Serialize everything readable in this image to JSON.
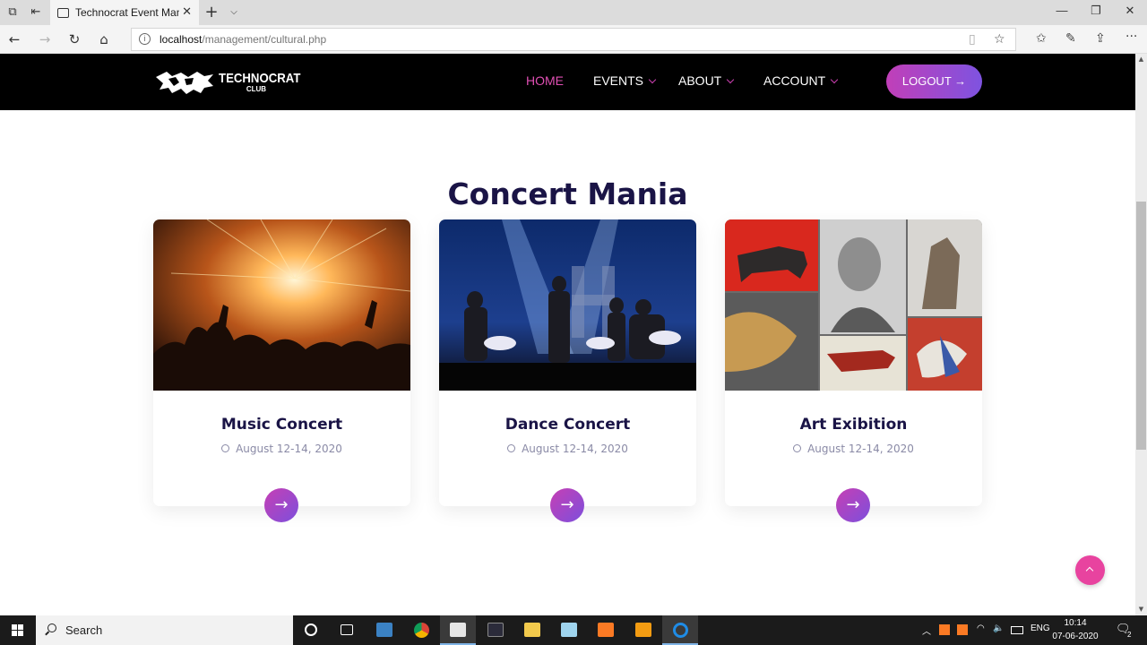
{
  "browser": {
    "tab_title": "Technocrat Event Manag",
    "url_host": "localhost",
    "url_path": "/management/cultural.php"
  },
  "site": {
    "logo": {
      "line1": "TECHNOCRAT",
      "line2": "CLUB"
    },
    "menu": [
      {
        "label": "HOME",
        "active": true,
        "dropdown": false
      },
      {
        "label": "EVENTS",
        "active": false,
        "dropdown": true
      },
      {
        "label": "ABOUT",
        "active": false,
        "dropdown": true
      },
      {
        "label": "ACCOUNT",
        "active": false,
        "dropdown": true
      }
    ],
    "logout_label": "LOGOUT →"
  },
  "section": {
    "title": "Concert Mania"
  },
  "cards": [
    {
      "title": "Music Concert",
      "date": "August 12-14, 2020",
      "image": "concert-crowd-photo",
      "arrow": "→"
    },
    {
      "title": "Dance Concert",
      "date": "August 12-14, 2020",
      "image": "dance-stage-photo",
      "arrow": "→"
    },
    {
      "title": "Art Exibition",
      "date": "August 12-14, 2020",
      "image": "art-collage-photo",
      "arrow": "→"
    }
  ],
  "taskbar": {
    "search_label": "Search",
    "language": "ENG",
    "time": "10:14",
    "date": "07-06-2020",
    "notification_count": "2"
  },
  "colors": {
    "accent_pink": "#e04fb3",
    "gradient_start": "#c13fb8",
    "gradient_end": "#7e53e0",
    "heading": "#1a1446",
    "header_bg": "#000000",
    "back_to_top": "#e8439f"
  },
  "icons": [
    "tab-actions-icon",
    "back-arrow-icon",
    "forward-arrow-icon",
    "refresh-icon",
    "home-icon",
    "info-icon",
    "reading-view-icon",
    "favorite-star-icon",
    "favorites-list-icon",
    "pen-icon",
    "share-icon",
    "more-icon",
    "clock-icon",
    "arrow-right-icon",
    "chevron-up-icon",
    "windows-start-icon",
    "search-icon"
  ]
}
